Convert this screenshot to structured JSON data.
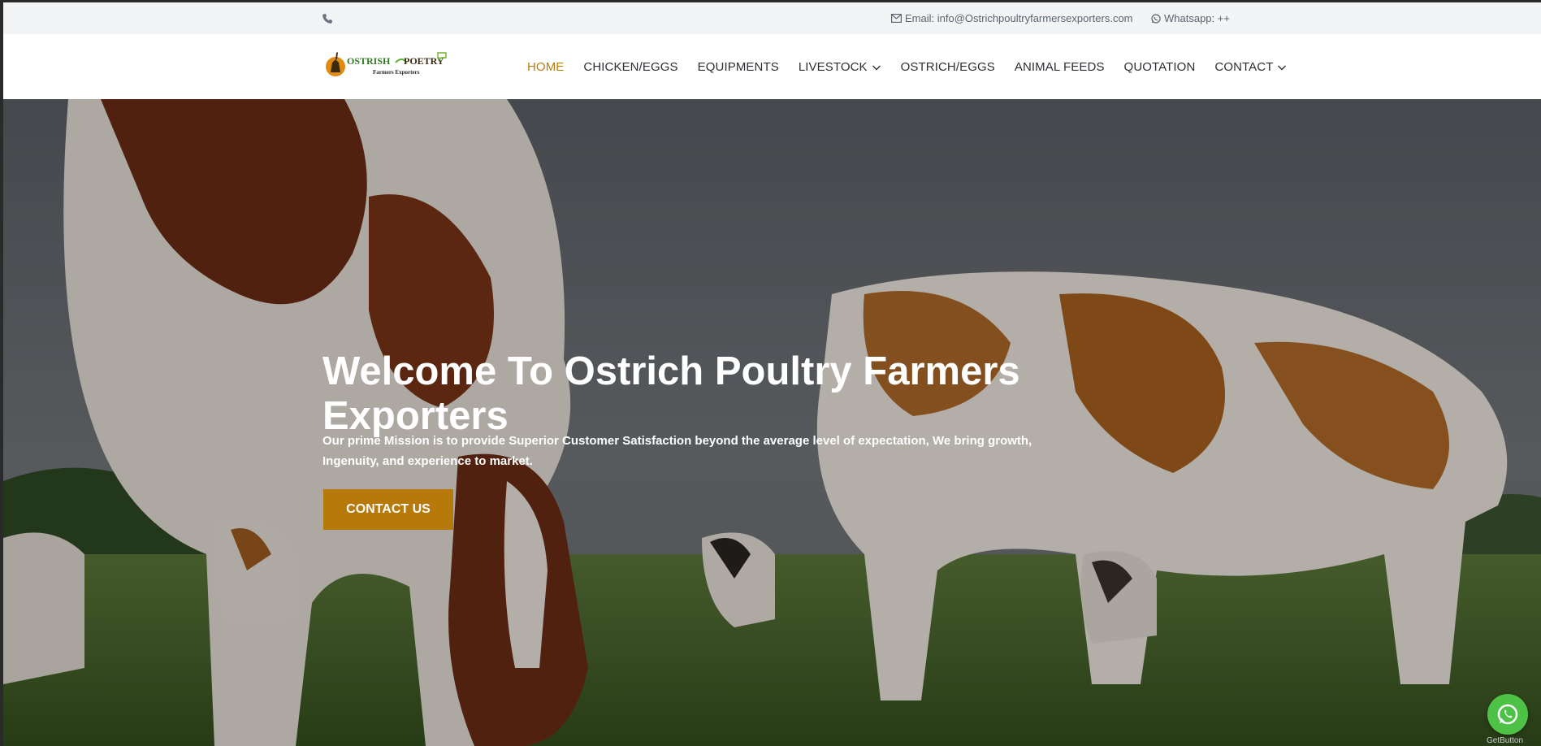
{
  "topbar": {
    "email": "Email: info@Ostrichpoultryfarmersexporters.com",
    "whatsapp": "Whatsapp: ++"
  },
  "brand": {
    "logo_text_1": "OSTRISH",
    "logo_text_2": "POETRY",
    "logo_sub": "Farmers Exporters"
  },
  "nav": {
    "items": [
      {
        "label": "HOME",
        "active": true
      },
      {
        "label": "CHICKEN/EGGS"
      },
      {
        "label": "EQUIPMENTS"
      },
      {
        "label": "LIVESTOCK",
        "dropdown": true
      },
      {
        "label": "OSTRICH/EGGS"
      },
      {
        "label": "ANIMAL FEEDS"
      },
      {
        "label": "QUOTATION"
      },
      {
        "label": "CONTACT",
        "dropdown": true
      }
    ]
  },
  "hero": {
    "title": "Welcome To Ostrich Poultry Farmers Exporters",
    "text": "Our prime Mission is to provide Superior Customer Satisfaction beyond the average level of expectation, We bring growth, Ingenuity, and experience to market.",
    "cta": "CONTACT US"
  },
  "widget": {
    "getbutton": "GetButton"
  },
  "colors": {
    "accent": "#bb7d10",
    "cta_bg": "#b8790b",
    "whatsapp_green": "#4dc247"
  }
}
